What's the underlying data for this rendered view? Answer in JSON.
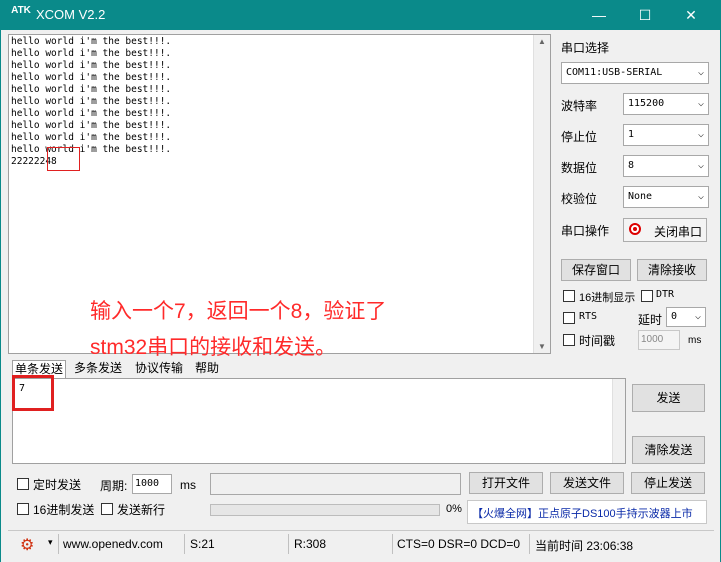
{
  "window": {
    "title": "XCOM V2.2",
    "logo_text": "ATK"
  },
  "window_controls": {
    "minimize": "—",
    "maximize": "☐",
    "close": "✕"
  },
  "receive_lines": [
    "hello world i'm the best!!!.",
    "hello world i'm the best!!!.",
    "hello world i'm the best!!!.",
    "hello world i'm the best!!!.",
    "hello world i'm the best!!!.",
    "hello world i'm the best!!!.",
    "hello world i'm the best!!!.",
    "hello world i'm the best!!!.",
    "hello world i'm the best!!!.",
    "hello world i'm the best!!!.",
    "22222248"
  ],
  "settings": {
    "port_select_label": "串口选择",
    "port_value": "COM11:USB-SERIAL",
    "baud_label": "波特率",
    "baud_value": "115200",
    "stop_label": "停止位",
    "stop_value": "1",
    "data_label": "数据位",
    "data_value": "8",
    "parity_label": "校验位",
    "parity_value": "None",
    "port_op_label": "串口操作",
    "close_port_button": "关闭串口",
    "save_window_button": "保存窗口",
    "clear_receive_button": "清除接收",
    "hex_display_label": "16进制显示",
    "dtr_label": "DTR",
    "rts_label": "RTS",
    "delay_label": "延时",
    "delay_value": "0",
    "timestamp_label": "时间戳",
    "timestamp_value": "1000",
    "ms_label": "ms"
  },
  "annotation": {
    "line1": "输入一个7，返回一个8，验证了",
    "line2": "stm32串口的接收和发送。",
    "color": "#ff2a2a"
  },
  "tabs": [
    "单条发送",
    "多条发送",
    "协议传输",
    "帮助"
  ],
  "send": {
    "value": "7",
    "send_button": "发送",
    "clear_send_button": "清除发送",
    "timed_send_label": "定时发送",
    "period_label": "周期:",
    "period_value": "1000",
    "ms_label": "ms",
    "open_file_button": "打开文件",
    "send_file_button": "发送文件",
    "stop_send_button": "停止发送",
    "hex_send_label": "16进制发送",
    "newline_label": "发送新行",
    "progress_label": "0%",
    "progress_fraction": 0,
    "ad_text": "【火爆全网】正点原子DS100手持示波器上市"
  },
  "status": {
    "url": "www.openedv.com",
    "sent": "S:21",
    "received": "R:308",
    "lines": "CTS=0 DSR=0 DCD=0",
    "time": "当前时间 23:06:38"
  },
  "colors": {
    "titlebar": "#0a8a8a",
    "accent_red": "#e02020"
  }
}
